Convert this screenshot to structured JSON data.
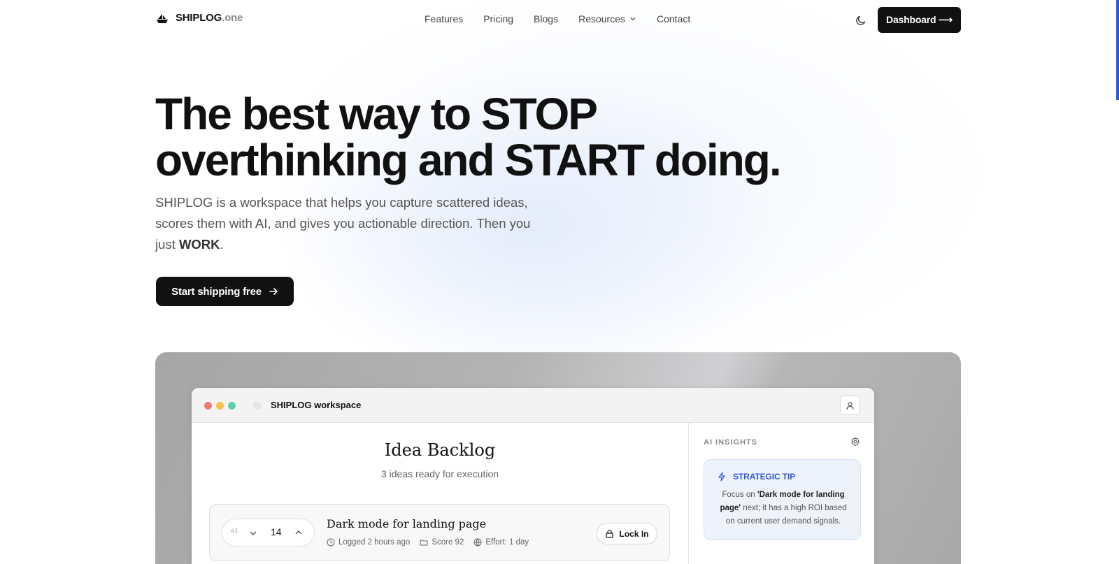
{
  "nav": {
    "brand_name": "SHIPLOG",
    "brand_suffix": ".one",
    "links": [
      {
        "label": "Features"
      },
      {
        "label": "Pricing"
      },
      {
        "label": "Blogs"
      },
      {
        "label": "Resources"
      },
      {
        "label": "Contact"
      }
    ],
    "dashboard_label": "Dashboard ⟶"
  },
  "hero": {
    "title_line1": "The best way to STOP",
    "title_line2": "overthinking and START doing.",
    "subtitle_part1": "SHIPLOG is a workspace that helps you capture scattered ideas, scores them with AI, and gives you actionable direction. Then you just ",
    "subtitle_bold": "WORK",
    "subtitle_end": ".",
    "cta_label": "Start shipping free"
  },
  "workspace": {
    "window_title": "SHIPLOG workspace",
    "backlog_title": "Idea Backlog",
    "backlog_subtitle": "3 ideas ready for execution",
    "idea": {
      "rank": "#1",
      "votes": "14",
      "title": "Dark mode for landing page",
      "logged": "Logged 2 hours ago",
      "score": "Score 92",
      "effort": "Effort: 1 day",
      "lock_label": "Lock In"
    },
    "insights": {
      "label": "AI INSIGHTS",
      "tip_title": "STRATEGIC TIP",
      "tip_prefix": "Focus on ",
      "tip_bold": "'Dark mode for landing page'",
      "tip_suffix": " next; it has a high ROI based on current user demand signals."
    }
  },
  "colors": {
    "accent_blue": "#2d5bd8",
    "button_dark": "#111111",
    "window_dot_red": "#f07a7a",
    "window_dot_yellow": "#f3c34d",
    "window_dot_green": "#5fcfa5"
  }
}
